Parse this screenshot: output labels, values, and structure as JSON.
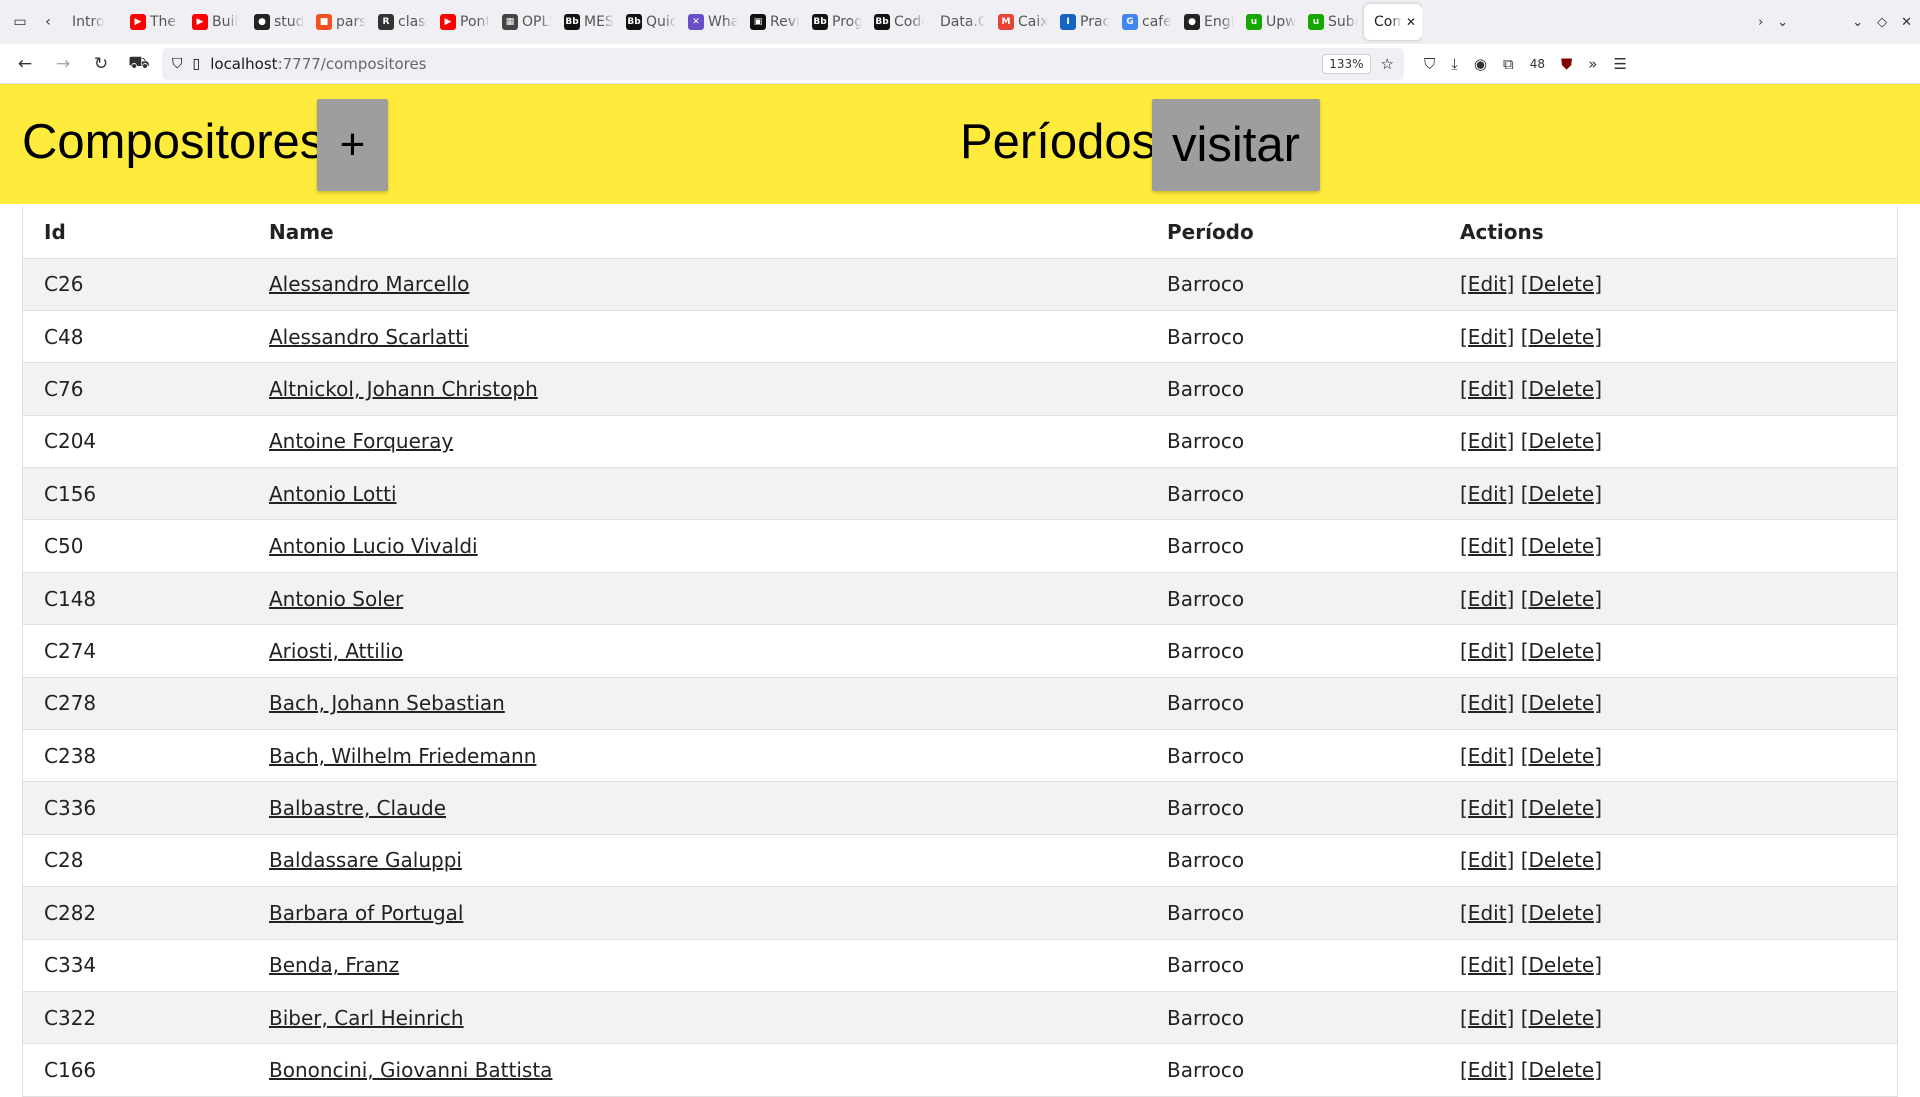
{
  "browser": {
    "tabs": [
      {
        "label": "Intro",
        "color": "#777777",
        "glyph": ""
      },
      {
        "label": "The I",
        "color": "#ff0000",
        "glyph": "▶"
      },
      {
        "label": "Buil",
        "color": "#ff0000",
        "glyph": "▶"
      },
      {
        "label": "stud",
        "color": "#222222",
        "glyph": "●"
      },
      {
        "label": "pars",
        "color": "#f25022",
        "glyph": "■"
      },
      {
        "label": "class",
        "color": "#333333",
        "glyph": "R"
      },
      {
        "label": "Pont",
        "color": "#ff0000",
        "glyph": "▶"
      },
      {
        "label": "OPLS",
        "color": "#444444",
        "glyph": "▦"
      },
      {
        "label": "MES",
        "color": "#111111",
        "glyph": "Bb"
      },
      {
        "label": "Quic",
        "color": "#111111",
        "glyph": "Bb"
      },
      {
        "label": "Wha",
        "color": "#6a4fc9",
        "glyph": "✕"
      },
      {
        "label": "Revi",
        "color": "#111111",
        "glyph": "▣"
      },
      {
        "label": "Prog",
        "color": "#111111",
        "glyph": "Bb"
      },
      {
        "label": "Code",
        "color": "#111111",
        "glyph": "Bb"
      },
      {
        "label": "Data.Ch",
        "color": "#ffffff",
        "glyph": ""
      },
      {
        "label": "Caix",
        "color": "#ea4335",
        "glyph": "M"
      },
      {
        "label": "Prac",
        "color": "#1565c0",
        "glyph": "I"
      },
      {
        "label": "cafe",
        "color": "#4285f4",
        "glyph": "G"
      },
      {
        "label": "Engl",
        "color": "#222222",
        "glyph": "●"
      },
      {
        "label": "Upw",
        "color": "#14a800",
        "glyph": "u"
      },
      {
        "label": "Subr",
        "color": "#14a800",
        "glyph": "u"
      },
      {
        "label": "Comp",
        "color": "#ffffff",
        "glyph": "",
        "active": true
      }
    ],
    "url_host": "localhost",
    "url_path": ":7777/compositores",
    "zoom": "133%",
    "badge": "48"
  },
  "header": {
    "title": "Compositores",
    "add_label": "+",
    "periods_title": "Períodos",
    "visit_label": "visitar",
    "bg_color": "#ffeb3b",
    "button_color": "#9e9e9e"
  },
  "table": {
    "columns": [
      "Id",
      "Name",
      "Período",
      "Actions"
    ],
    "edit_label": "[Edit]",
    "delete_label": "[Delete]",
    "rows": [
      {
        "id": "C26",
        "name": "Alessandro Marcello",
        "periodo": "Barroco"
      },
      {
        "id": "C48",
        "name": "Alessandro Scarlatti",
        "periodo": "Barroco"
      },
      {
        "id": "C76",
        "name": "Altnickol, Johann Christoph",
        "periodo": "Barroco"
      },
      {
        "id": "C204",
        "name": "Antoine Forqueray",
        "periodo": "Barroco"
      },
      {
        "id": "C156",
        "name": "Antonio Lotti",
        "periodo": "Barroco"
      },
      {
        "id": "C50",
        "name": "Antonio Lucio Vivaldi",
        "periodo": "Barroco"
      },
      {
        "id": "C148",
        "name": "Antonio Soler",
        "periodo": "Barroco"
      },
      {
        "id": "C274",
        "name": "Ariosti, Attilio",
        "periodo": "Barroco"
      },
      {
        "id": "C278",
        "name": "Bach, Johann Sebastian",
        "periodo": "Barroco"
      },
      {
        "id": "C238",
        "name": "Bach, Wilhelm Friedemann",
        "periodo": "Barroco"
      },
      {
        "id": "C336",
        "name": "Balbastre, Claude",
        "periodo": "Barroco"
      },
      {
        "id": "C28",
        "name": "Baldassare Galuppi",
        "periodo": "Barroco"
      },
      {
        "id": "C282",
        "name": "Barbara of Portugal",
        "periodo": "Barroco"
      },
      {
        "id": "C334",
        "name": "Benda, Franz",
        "periodo": "Barroco"
      },
      {
        "id": "C322",
        "name": "Biber, Carl Heinrich",
        "periodo": "Barroco"
      },
      {
        "id": "C166",
        "name": "Bononcini, Giovanni Battista",
        "periodo": "Barroco"
      }
    ]
  }
}
